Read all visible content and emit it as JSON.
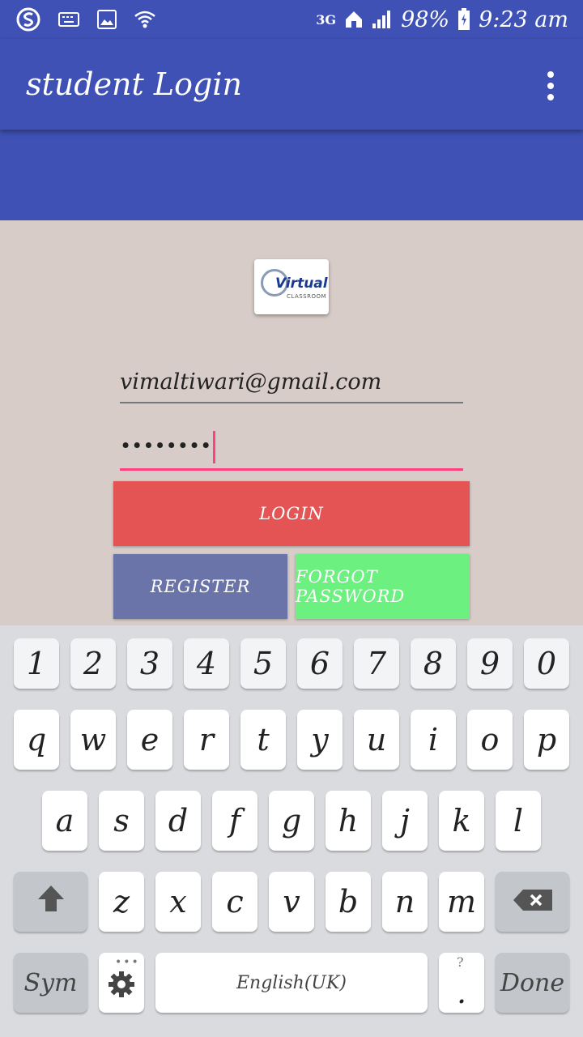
{
  "status_bar": {
    "network": "3G",
    "battery": "98%",
    "time": "9:23 am",
    "icons": [
      "s-logo-icon",
      "keyboard-icon",
      "image-icon",
      "wifi-icon",
      "network-3g-icon",
      "home-data-icon",
      "signal-icon",
      "battery-charging-icon"
    ]
  },
  "app_bar": {
    "title": "student Login",
    "overflow_icon": "more-vert-icon"
  },
  "logo": {
    "text": "Virtual",
    "subtext": "CLASSROOM"
  },
  "form": {
    "email_value": "vimaltiwari@gmail.com",
    "password_value": "••••••••"
  },
  "buttons": {
    "login": "LOGIN",
    "register": "REGISTER",
    "forgot": "FORGOT PASSWORD"
  },
  "colors": {
    "primary": "#3f51b5",
    "accent": "#ff4081",
    "login": "#e55454",
    "register": "#6a74a8",
    "forgot": "#6cf080",
    "background": "#d7ccc8"
  },
  "keyboard": {
    "row1": [
      "1",
      "2",
      "3",
      "4",
      "5",
      "6",
      "7",
      "8",
      "9",
      "0"
    ],
    "row2": [
      "q",
      "w",
      "e",
      "r",
      "t",
      "y",
      "u",
      "i",
      "o",
      "p"
    ],
    "row3": [
      "a",
      "s",
      "d",
      "f",
      "g",
      "h",
      "j",
      "k",
      "l"
    ],
    "row4": [
      "z",
      "x",
      "c",
      "v",
      "b",
      "n",
      "m"
    ],
    "sym": "Sym",
    "space": "English(UK)",
    "period": ".",
    "period_hint": "?",
    "done": "Done",
    "settings_icon": "gear-icon",
    "shift_icon": "shift-arrow-icon",
    "backspace_icon": "backspace-icon"
  }
}
